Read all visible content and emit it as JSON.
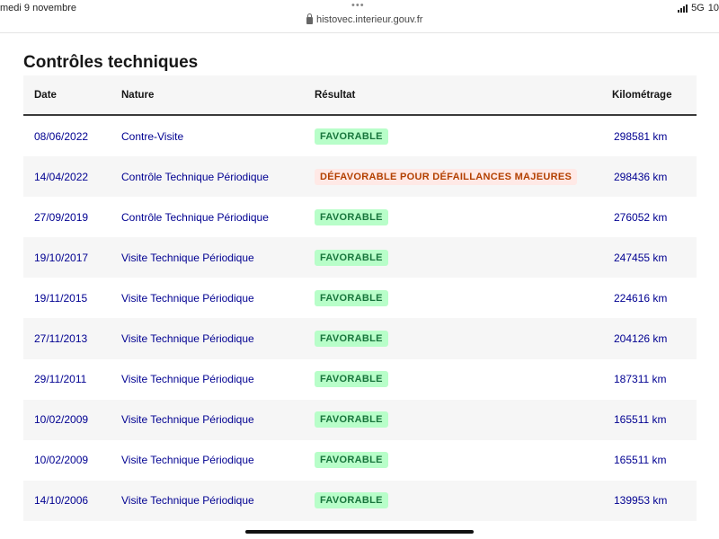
{
  "statusbar": {
    "date": "medi 9 novembre",
    "dots": "•••",
    "url": "histovec.interieur.gouv.fr",
    "network": "5G",
    "battery": "10"
  },
  "page": {
    "title": "Contrôles techniques"
  },
  "table": {
    "headers": {
      "date": "Date",
      "nature": "Nature",
      "result": "Résultat",
      "km": "Kilométrage"
    },
    "rows": [
      {
        "date": "08/06/2022",
        "nature": "Contre-Visite",
        "result": "FAVORABLE",
        "status": "ok",
        "km": "298581 km"
      },
      {
        "date": "14/04/2022",
        "nature": "Contrôle Technique Périodique",
        "result": "DÉFAVORABLE POUR DÉFAILLANCES MAJEURES",
        "status": "ko",
        "km": "298436 km"
      },
      {
        "date": "27/09/2019",
        "nature": "Contrôle Technique Périodique",
        "result": "FAVORABLE",
        "status": "ok",
        "km": "276052 km"
      },
      {
        "date": "19/10/2017",
        "nature": "Visite Technique Périodique",
        "result": "FAVORABLE",
        "status": "ok",
        "km": "247455 km"
      },
      {
        "date": "19/11/2015",
        "nature": "Visite Technique Périodique",
        "result": "FAVORABLE",
        "status": "ok",
        "km": "224616 km"
      },
      {
        "date": "27/11/2013",
        "nature": "Visite Technique Périodique",
        "result": "FAVORABLE",
        "status": "ok",
        "km": "204126 km"
      },
      {
        "date": "29/11/2011",
        "nature": "Visite Technique Périodique",
        "result": "FAVORABLE",
        "status": "ok",
        "km": "187311 km"
      },
      {
        "date": "10/02/2009",
        "nature": "Visite Technique Périodique",
        "result": "FAVORABLE",
        "status": "ok",
        "km": "165511 km"
      },
      {
        "date": "10/02/2009",
        "nature": "Visite Technique Périodique",
        "result": "FAVORABLE",
        "status": "ok",
        "km": "165511 km"
      },
      {
        "date": "14/10/2006",
        "nature": "Visite Technique Périodique",
        "result": "FAVORABLE",
        "status": "ok",
        "km": "139953 km"
      }
    ]
  },
  "colors": {
    "link_text": "#000091",
    "favorable_bg": "#b8fec9",
    "favorable_text": "#18753c",
    "defavorable_bg": "#ffe9e6",
    "defavorable_text": "#b34000"
  }
}
